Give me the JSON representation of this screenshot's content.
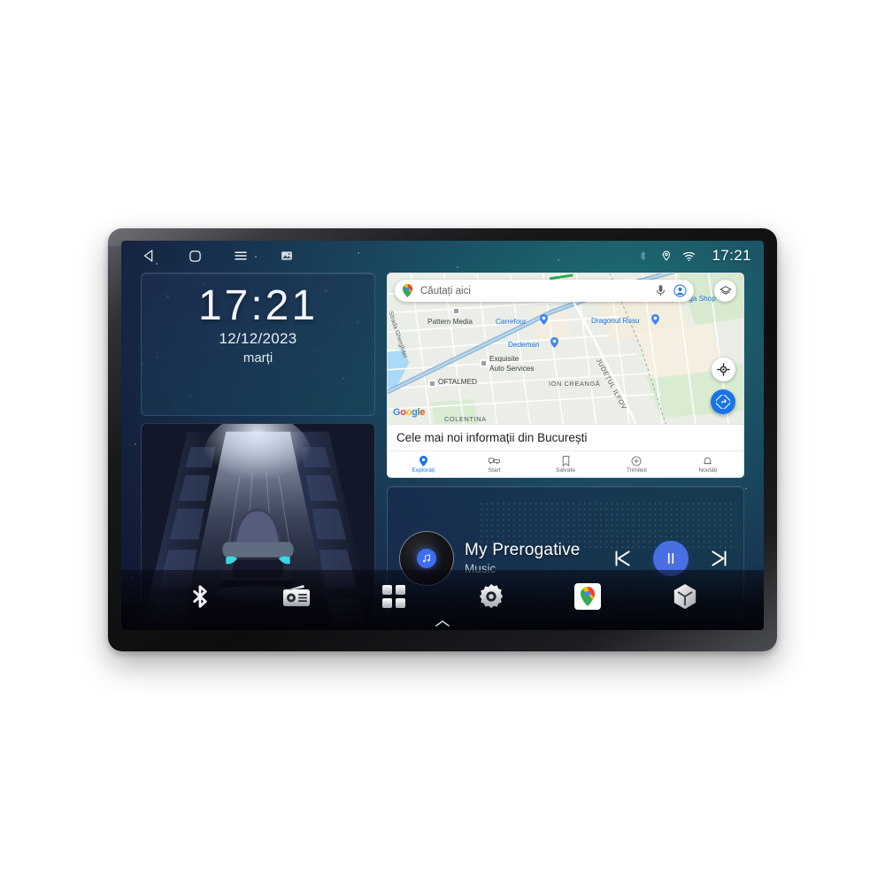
{
  "device": {
    "name": "car-head-unit"
  },
  "statusbar": {
    "nav": [
      {
        "name": "back-icon",
        "label": "Back"
      },
      {
        "name": "home-icon",
        "label": "Home"
      },
      {
        "name": "menu-icon",
        "label": "Menu"
      },
      {
        "name": "screenshot-icon",
        "label": "Screenshot"
      }
    ],
    "system": [
      {
        "name": "bluetooth-icon",
        "label": "Bluetooth"
      },
      {
        "name": "location-icon",
        "label": "Location"
      },
      {
        "name": "wifi-icon",
        "label": "Wi-Fi"
      }
    ],
    "clock": "17:21"
  },
  "clock_widget": {
    "time": "17:21",
    "date": "12/12/2023",
    "weekday": "marți"
  },
  "car_widget": {
    "label": "car-animation"
  },
  "map": {
    "search_placeholder": "Căutați aici",
    "icons": {
      "mic": "mic-icon",
      "account": "account-icon",
      "layers": "layers-icon",
      "my_location": "my-location-icon",
      "directions": "directions-icon"
    },
    "logo": "Google",
    "pois": [
      {
        "name": "Strada Gherghitei",
        "type": "street"
      },
      {
        "name": "Pattern Media",
        "type": "place"
      },
      {
        "name": "Carrefour",
        "type": "brand"
      },
      {
        "name": "Dragonul Rosu",
        "type": "brand"
      },
      {
        "name": "Mega Shop",
        "type": "brand"
      },
      {
        "name": "Dedeman",
        "type": "brand"
      },
      {
        "name": "Exquisite",
        "type": "place"
      },
      {
        "name": "Auto Services",
        "type": "place"
      },
      {
        "name": "OFTALMED",
        "type": "place"
      },
      {
        "name": "ION CREANGĂ",
        "type": "area"
      },
      {
        "name": "JUDEȚUL ILFOV",
        "type": "area"
      },
      {
        "name": "COLENTINA",
        "type": "area"
      }
    ],
    "news_text": "Cele mai noi informații din București",
    "tabs": [
      {
        "label": "Explorați",
        "icon": "explore-pin-icon",
        "active": true
      },
      {
        "label": "Start",
        "icon": "commute-icon",
        "active": false
      },
      {
        "label": "Salvate",
        "icon": "bookmark-icon",
        "active": false
      },
      {
        "label": "Trimiteți",
        "icon": "contribute-icon",
        "active": false
      },
      {
        "label": "Noutăți",
        "icon": "bell-icon",
        "active": false
      }
    ]
  },
  "music": {
    "title": "My Prerogative",
    "subtitle": "Music",
    "album_icon": "vinyl-record-icon",
    "controls": [
      {
        "name": "previous-track-button",
        "icon": "skip-previous-icon"
      },
      {
        "name": "play-pause-button",
        "icon": "pause-icon"
      },
      {
        "name": "next-track-button",
        "icon": "skip-next-icon"
      }
    ]
  },
  "dock": [
    {
      "name": "bluetooth-app-icon",
      "label": "Bluetooth"
    },
    {
      "name": "radio-app-icon",
      "label": "Radio"
    },
    {
      "name": "apps-grid-icon",
      "label": "Apps"
    },
    {
      "name": "settings-gear-icon",
      "label": "Settings"
    },
    {
      "name": "google-maps-app-icon",
      "label": "Maps"
    },
    {
      "name": "cube-app-icon",
      "label": "Apps 3D"
    }
  ],
  "home_handle": {
    "name": "home-handle",
    "icon": "chevron-up-icon"
  },
  "colors": {
    "accent_blue": "#1a73e8",
    "music_blue": "#4a6fe3",
    "bg_teal": "#1d6f72",
    "bg_navy": "#0d1226"
  }
}
